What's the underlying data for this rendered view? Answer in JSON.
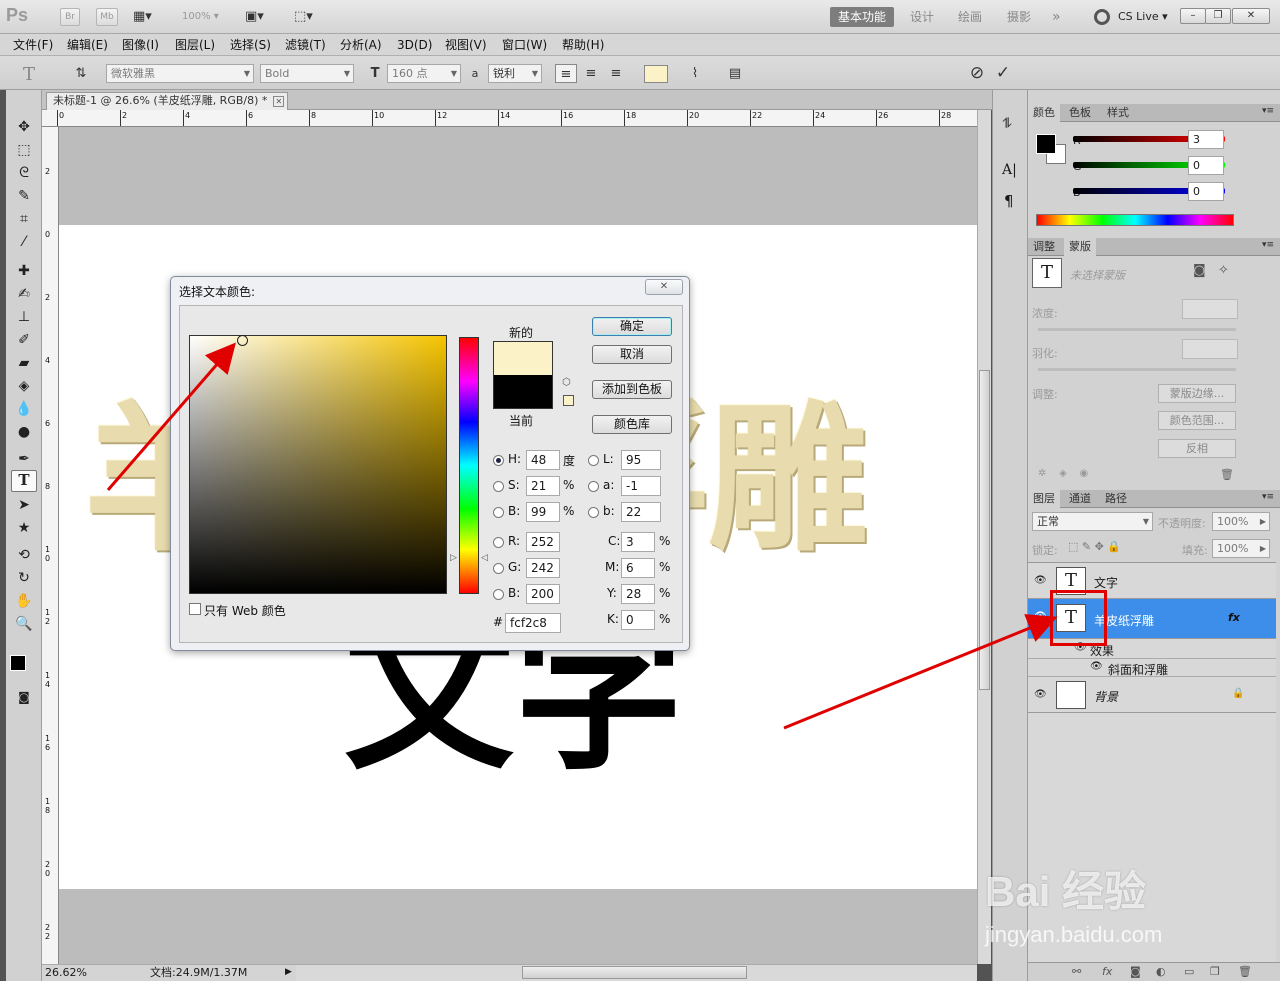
{
  "appbar": {
    "logo": "Ps",
    "bridge_btn": "Br",
    "minibridge_btn": "Mb",
    "zoom_value": "100%",
    "workspaces": [
      "基本功能",
      "设计",
      "绘画",
      "摄影"
    ],
    "workspace_more": "»",
    "cs_live": "CS Live",
    "window_controls": [
      "–",
      "❐",
      "✕"
    ]
  },
  "menu": {
    "items": [
      "文件(F)",
      "编辑(E)",
      "图像(I)",
      "图层(L)",
      "选择(S)",
      "滤镜(T)",
      "分析(A)",
      "3D(D)",
      "视图(V)",
      "窗口(W)",
      "帮助(H)"
    ]
  },
  "options": {
    "font_family": "微软雅黑",
    "font_style": "Bold",
    "font_size": "160 点",
    "aa_label": "a",
    "aa_mode": "锐利",
    "swatch_color": "#fcf2c8",
    "cancel_icon": "⊘",
    "commit_icon": "✓"
  },
  "document": {
    "tab_title": "未标题-1 @ 26.6% (羊皮纸浮雕, RGB/8) *",
    "emboss_text": "羊皮纸浮雕",
    "black_text": "文字",
    "ruler_top": [
      "0",
      "2",
      "4",
      "6",
      "8",
      "10",
      "12",
      "14",
      "16",
      "18",
      "20",
      "22",
      "24",
      "26",
      "28"
    ],
    "ruler_left": [
      "2",
      "0",
      "2",
      "4",
      "6",
      "8",
      "1\n0",
      "1\n2",
      "1\n4",
      "1\n6",
      "1\n8",
      "2\n0",
      "2\n2"
    ]
  },
  "status": {
    "zoom": "26.62%",
    "doc_info": "文档:24.9M/1.37M"
  },
  "color_panel": {
    "tabs": [
      "颜色",
      "色板",
      "样式"
    ],
    "r_label": "R",
    "g_label": "G",
    "b_label": "B",
    "r": "3",
    "g": "0",
    "b": "0"
  },
  "masks_panel": {
    "tabs": [
      "调整",
      "蒙版"
    ],
    "mask_status": "未选择蒙版",
    "density_label": "浓度:",
    "feather_label": "羽化:",
    "refine_label": "调整:",
    "btn_mask_edge": "蒙版边缘...",
    "btn_color_range": "颜色范围...",
    "btn_invert": "反相"
  },
  "layers_panel": {
    "tabs": [
      "图层",
      "通道",
      "路径"
    ],
    "blend_mode": "正常",
    "opacity_label": "不透明度:",
    "opacity": "100%",
    "lock_label": "锁定:",
    "fill_label": "填充:",
    "fill": "100%",
    "layers": [
      {
        "name": "文字",
        "thumb": "T"
      },
      {
        "name": "羊皮纸浮雕",
        "thumb": "T",
        "fx": "fx"
      },
      {
        "name": "背景",
        "thumb": ""
      }
    ],
    "effects_label": "效果",
    "effect_item": "斜面和浮雕"
  },
  "dialog": {
    "title": "选择文本颜色:",
    "close": "✕",
    "new_label": "新的",
    "current_label": "当前",
    "new_color": "#fcf2c8",
    "current_color": "#000000",
    "btn_ok": "确定",
    "btn_cancel": "取消",
    "btn_add_swatch": "添加到色板",
    "btn_color_lib": "颜色库",
    "h_label": "H:",
    "h": "48",
    "h_unit": "度",
    "s_label": "S:",
    "s": "21",
    "s_unit": "%",
    "bb_label": "B:",
    "bb": "99",
    "bb_unit": "%",
    "r_label": "R:",
    "r": "252",
    "g_label": "G:",
    "g": "242",
    "b_label": "B:",
    "b": "200",
    "l_label": "L:",
    "l": "95",
    "a_label": "a:",
    "a": "-1",
    "lab_b_label": "b:",
    "lab_b": "22",
    "c_label": "C:",
    "c": "3",
    "m_label": "M:",
    "m": "6",
    "y_label": "Y:",
    "y": "28",
    "k_label": "K:",
    "k": "0",
    "pct": "%",
    "hex_label": "#",
    "hex": "fcf2c8",
    "web_only_label": "只有 Web 颜色"
  },
  "watermark": {
    "main": "Bai 经验",
    "url": "jingyan.baidu.com"
  }
}
